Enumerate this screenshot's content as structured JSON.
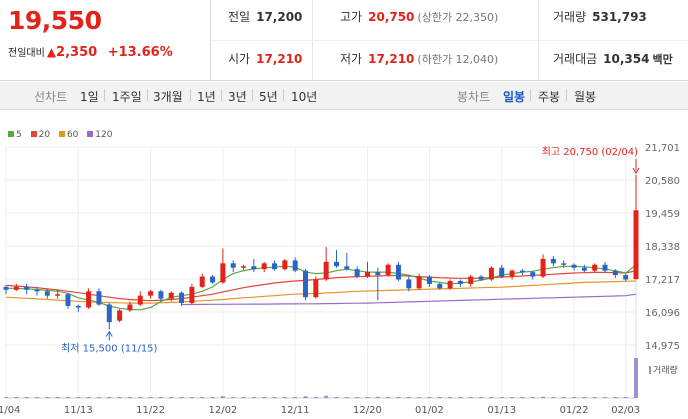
{
  "quote": {
    "price": "19,550",
    "change_label": "전일대비",
    "change_arrow": "▲",
    "change_amount": "2,350",
    "change_rate": "+13.66%",
    "prev_close_label": "전일",
    "prev_close": "17,200",
    "high_label": "고가",
    "high": "20,750",
    "upper_limit": "(상한가 22,350)",
    "volume_label": "거래량",
    "volume": "531,793",
    "open_label": "시가",
    "open": "17,210",
    "low_label": "저가",
    "low": "17,210",
    "lower_limit": "(하한가 12,040)",
    "value_label": "거래대금",
    "value": "10,354",
    "value_unit": "백만"
  },
  "tabs": {
    "chart_type_label": "선차트",
    "ranges": [
      "1일",
      "1주일",
      "3개월",
      "1년",
      "3년",
      "5년",
      "10년"
    ],
    "candle_label": "봉차트",
    "periods": [
      "일봉",
      "주봉",
      "월봉"
    ],
    "active_period": "일봉"
  },
  "colors": {
    "up": "#e2231a",
    "down": "#2a64c5",
    "ma5": "#59a845",
    "ma20": "#e2453c",
    "ma60": "#e8942c",
    "ma120": "#9a6cc6",
    "volume": "#9e92d0"
  },
  "chart_data": {
    "type": "candlestick",
    "legend": [
      {
        "name": "5",
        "color": "#59a845"
      },
      {
        "name": "20",
        "color": "#e2453c"
      },
      {
        "name": "60",
        "color": "#e8942c"
      },
      {
        "name": "120",
        "color": "#9a6cc6"
      }
    ],
    "y_ticks": [
      "21,701",
      "20,580",
      "19,459",
      "18,338",
      "17,217",
      "16,096",
      "14,975"
    ],
    "y_tick_values": [
      21701,
      20580,
      19459,
      18338,
      17217,
      16096,
      14975
    ],
    "ylim": [
      14975,
      21701
    ],
    "x_labels": [
      "11/04",
      "11/13",
      "11/22",
      "12/02",
      "12/11",
      "12/20",
      "01/02",
      "01/13",
      "01/22",
      "02/03"
    ],
    "x_label_index": [
      0,
      7,
      14,
      21,
      28,
      35,
      41,
      48,
      55,
      60
    ],
    "candles": [
      [
        16950,
        16850,
        17000,
        16700
      ],
      [
        16850,
        16950,
        17050,
        16800
      ],
      [
        16950,
        16850,
        17050,
        16700
      ],
      [
        16850,
        16800,
        16950,
        16650
      ],
      [
        16800,
        16650,
        16900,
        16550
      ],
      [
        16650,
        16700,
        16850,
        16550
      ],
      [
        16700,
        16300,
        16750,
        16200
      ],
      [
        16300,
        16250,
        16350,
        16100
      ],
      [
        16250,
        16800,
        16900,
        16200
      ],
      [
        16800,
        16350,
        16900,
        16300
      ],
      [
        16350,
        15750,
        16400,
        15500
      ],
      [
        15800,
        16150,
        16200,
        15750
      ],
      [
        16150,
        16350,
        16450,
        16100
      ],
      [
        16350,
        16650,
        16800,
        16300
      ],
      [
        16650,
        16800,
        16850,
        16550
      ],
      [
        16800,
        16550,
        16850,
        16450
      ],
      [
        16550,
        16750,
        16800,
        16450
      ],
      [
        16750,
        16400,
        16800,
        16300
      ],
      [
        16400,
        16950,
        17050,
        16350
      ],
      [
        16950,
        17300,
        17400,
        16900
      ],
      [
        17300,
        17100,
        17350,
        17050
      ],
      [
        17100,
        17750,
        18250,
        17050
      ],
      [
        17750,
        17600,
        17850,
        17450
      ],
      [
        17600,
        17650,
        17700,
        17500
      ],
      [
        17650,
        17550,
        17900,
        17450
      ],
      [
        17550,
        17750,
        17800,
        17450
      ],
      [
        17750,
        17550,
        17850,
        17500
      ],
      [
        17550,
        17850,
        17900,
        17500
      ],
      [
        17850,
        17500,
        17950,
        17450
      ],
      [
        17500,
        16600,
        17550,
        16500
      ],
      [
        16600,
        17200,
        17300,
        16550
      ],
      [
        17200,
        17800,
        18300,
        17150
      ],
      [
        17800,
        17650,
        18200,
        17600
      ],
      [
        17650,
        17550,
        18100,
        17500
      ],
      [
        17550,
        17300,
        17650,
        17250
      ],
      [
        17300,
        17450,
        17800,
        17250
      ],
      [
        17450,
        17350,
        17600,
        16500
      ],
      [
        17350,
        17700,
        17750,
        17300
      ],
      [
        17700,
        17200,
        17800,
        17150
      ],
      [
        17200,
        16900,
        17300,
        16800
      ],
      [
        16900,
        17300,
        17400,
        16850
      ],
      [
        17300,
        17050,
        17350,
        16950
      ],
      [
        17050,
        16900,
        17100,
        16850
      ],
      [
        16900,
        17150,
        17200,
        16850
      ],
      [
        17150,
        17050,
        17200,
        16950
      ],
      [
        17050,
        17300,
        17350,
        16950
      ],
      [
        17300,
        17200,
        17350,
        17150
      ],
      [
        17200,
        17600,
        17650,
        17150
      ],
      [
        17600,
        17300,
        17700,
        17250
      ],
      [
        17300,
        17500,
        17550,
        17200
      ],
      [
        17500,
        17450,
        17550,
        17350
      ],
      [
        17450,
        17300,
        17500,
        17200
      ],
      [
        17300,
        17900,
        18050,
        17250
      ],
      [
        17900,
        17750,
        18000,
        17650
      ],
      [
        17750,
        17700,
        17850,
        17600
      ],
      [
        17700,
        17600,
        17750,
        17500
      ],
      [
        17600,
        17500,
        17700,
        17450
      ],
      [
        17500,
        17700,
        17750,
        17450
      ],
      [
        17700,
        17500,
        17800,
        17450
      ],
      [
        17500,
        17350,
        17550,
        17250
      ],
      [
        17350,
        17200,
        17400,
        17150
      ],
      [
        17210,
        19550,
        20750,
        17210
      ]
    ],
    "moving_averages": {
      "ma5": [
        16900,
        16900,
        16880,
        16860,
        16830,
        16800,
        16730,
        16580,
        16500,
        16420,
        16300,
        16220,
        16180,
        16170,
        16250,
        16450,
        16600,
        16650,
        16700,
        16800,
        16950,
        17200,
        17400,
        17500,
        17560,
        17600,
        17620,
        17650,
        17620,
        17450,
        17400,
        17420,
        17500,
        17550,
        17500,
        17450,
        17450,
        17450,
        17400,
        17350,
        17250,
        17150,
        17100,
        17050,
        17080,
        17120,
        17180,
        17250,
        17350,
        17400,
        17450,
        17480,
        17550,
        17600,
        17650,
        17650,
        17630,
        17600,
        17550,
        17500,
        17420,
        17700
      ],
      "ma20": [
        17000,
        16980,
        16950,
        16920,
        16880,
        16850,
        16800,
        16750,
        16700,
        16650,
        16600,
        16550,
        16520,
        16500,
        16480,
        16500,
        16520,
        16550,
        16600,
        16650,
        16700,
        16780,
        16850,
        16920,
        16980,
        17030,
        17080,
        17120,
        17150,
        17170,
        17200,
        17230,
        17260,
        17280,
        17300,
        17310,
        17320,
        17330,
        17330,
        17320,
        17300,
        17280,
        17260,
        17250,
        17240,
        17240,
        17250,
        17260,
        17280,
        17300,
        17320,
        17340,
        17360,
        17380,
        17400,
        17420,
        17430,
        17440,
        17440,
        17430,
        17420,
        17500
      ],
      "ma60": [
        16600,
        16580,
        16560,
        16540,
        16520,
        16500,
        16480,
        16460,
        16440,
        16430,
        16420,
        16410,
        16400,
        16400,
        16400,
        16410,
        16420,
        16440,
        16460,
        16480,
        16500,
        16520,
        16550,
        16580,
        16600,
        16630,
        16650,
        16680,
        16700,
        16710,
        16720,
        16740,
        16760,
        16780,
        16800,
        16810,
        16820,
        16830,
        16840,
        16850,
        16860,
        16870,
        16880,
        16890,
        16900,
        16910,
        16920,
        16930,
        16940,
        16960,
        16980,
        17000,
        17020,
        17040,
        17060,
        17080,
        17100,
        17110,
        17120,
        17130,
        17140,
        17150
      ],
      "ma120": [
        null,
        null,
        null,
        null,
        null,
        null,
        null,
        null,
        null,
        null,
        null,
        null,
        null,
        null,
        null,
        null,
        null,
        16350,
        16352,
        16354,
        16356,
        16358,
        16360,
        16362,
        16364,
        16366,
        16368,
        16370,
        16372,
        16374,
        16376,
        16380,
        16385,
        16390,
        16395,
        16400,
        16410,
        16420,
        16430,
        16440,
        16450,
        16460,
        16470,
        16480,
        16490,
        16500,
        16510,
        16520,
        16530,
        16540,
        16550,
        16560,
        16570,
        16580,
        16590,
        16600,
        16610,
        16620,
        16630,
        16640,
        16650,
        16700
      ]
    },
    "volume": [
      8000,
      6000,
      7000,
      5000,
      9000,
      6000,
      7000,
      10000,
      8000,
      12000,
      15000,
      9000,
      8000,
      7000,
      6000,
      9000,
      8000,
      7000,
      11000,
      14000,
      9000,
      25000,
      12000,
      9000,
      10000,
      8000,
      9000,
      11000,
      10000,
      24000,
      15000,
      30000,
      14000,
      11000,
      9000,
      8000,
      16000,
      10000,
      12000,
      11000,
      9000,
      8000,
      8000,
      7000,
      7000,
      9000,
      8000,
      13000,
      10000,
      9000,
      8000,
      8000,
      18000,
      12000,
      9000,
      8000,
      7000,
      9000,
      8000,
      9000,
      10000,
      531793
    ],
    "volume_label": "거래량",
    "annotations": {
      "max": {
        "text": "최고 20,750 (02/04)",
        "value": 20750,
        "index": 61
      },
      "min": {
        "text": "최저 15,500 (11/15)",
        "value": 15500,
        "index": 10
      }
    }
  }
}
